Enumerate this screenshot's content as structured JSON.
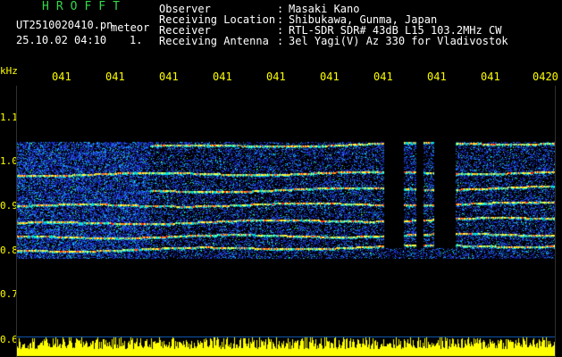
{
  "header": {
    "app_title": "HROFFT",
    "file_name": "UT2510020410.pn",
    "file_suffix": "meteor",
    "datetime": "25.10.02 04:10",
    "sequence": "1."
  },
  "info": [
    {
      "label": "Observer",
      "value": "Masaki Kano"
    },
    {
      "label": "Receiving Location",
      "value": "Shibukawa, Gunma, Japan"
    },
    {
      "label": "Receiver",
      "value": "RTL-SDR SDR# 43dB L15 103.2MHz CW"
    },
    {
      "label": "Receiving Antenna",
      "value": "3el Yagi(V) Az 330 for Vladivostok"
    }
  ],
  "axes": {
    "y_unit": "kHz",
    "y_labels": [
      "1.1",
      "1.0",
      "0.9",
      "0.8",
      "0.7",
      "0.6"
    ],
    "x_labels": [
      "041",
      "041",
      "041",
      "041",
      "041",
      "041",
      "041",
      "041",
      "041",
      "0420"
    ]
  },
  "colors": {
    "background": "#000000",
    "axis_text": "#ffff00",
    "title_green": "#35d84a",
    "signal_low": "#1a2fd0",
    "signal_mid": "#00e0e0",
    "signal_high": "#ff2020",
    "noise_strip": "#ffff00"
  },
  "spectrogram": {
    "meteor_echo_frequencies_khz": [
      1.03,
      0.97,
      0.93,
      0.9,
      0.86,
      0.83,
      0.8
    ]
  }
}
